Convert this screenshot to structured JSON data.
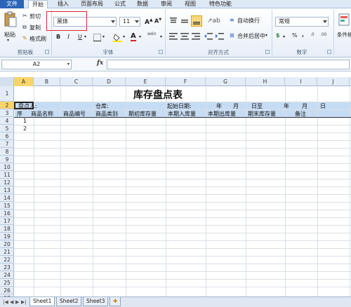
{
  "tabs": [
    "文件",
    "开始",
    "插入",
    "页面布局",
    "公式",
    "数据",
    "审阅",
    "视图",
    "特色功能"
  ],
  "clipboard": {
    "paste": "粘贴",
    "cut": "剪切",
    "copy": "复制",
    "format_painter": "格式刷",
    "group": "剪贴板"
  },
  "font": {
    "name": "黑体",
    "size": "11",
    "bold": "B",
    "italic": "I",
    "underline": "U",
    "group": "字体",
    "grow": "A",
    "shrink": "A",
    "wen": "wén"
  },
  "alignment": {
    "wrap": "自动换行",
    "merge": "合并后居中",
    "group": "对齐方式"
  },
  "number": {
    "format": "常规",
    "percent": "%",
    "comma": ",",
    "group": "数字"
  },
  "styles": {
    "conditional": "条件格"
  },
  "formula_bar": {
    "name_box": "A2",
    "fx": "fx",
    "formula": ""
  },
  "columns": [
    "A",
    "B",
    "C",
    "D",
    "E",
    "F",
    "G",
    "H",
    "I",
    "J"
  ],
  "rows": [
    "1",
    "2",
    "3",
    "4",
    "5",
    "6",
    "7",
    "8",
    "9",
    "10",
    "11",
    "12",
    "13",
    "14",
    "15",
    "16",
    "17",
    "18",
    "19",
    "20",
    "21",
    "22",
    "23",
    "24",
    "25",
    "26",
    "27"
  ],
  "sheet": {
    "title": "库存盘点表",
    "row2": {
      "counter": "盘点人:",
      "warehouse": "仓库:",
      "start_date": "起始日期:",
      "year1": "年",
      "month1": "月",
      "day_to": "日至",
      "year2": "年",
      "month2": "月",
      "day2": "日"
    },
    "headers": [
      "序",
      "商品名称",
      "商品编号",
      "商品类别",
      "期初库存量",
      "本期入库量",
      "本期出库量",
      "期末库存量",
      "备注"
    ],
    "seq": [
      "1",
      "2"
    ]
  },
  "sheet_tabs": [
    "Sheet1",
    "Sheet2",
    "Sheet3"
  ],
  "colors": {
    "header_band": "#c6dcf4",
    "selected_header": "#f8d46b",
    "file_tab": "#2a65b8",
    "highlight_box": "#e0292b"
  }
}
